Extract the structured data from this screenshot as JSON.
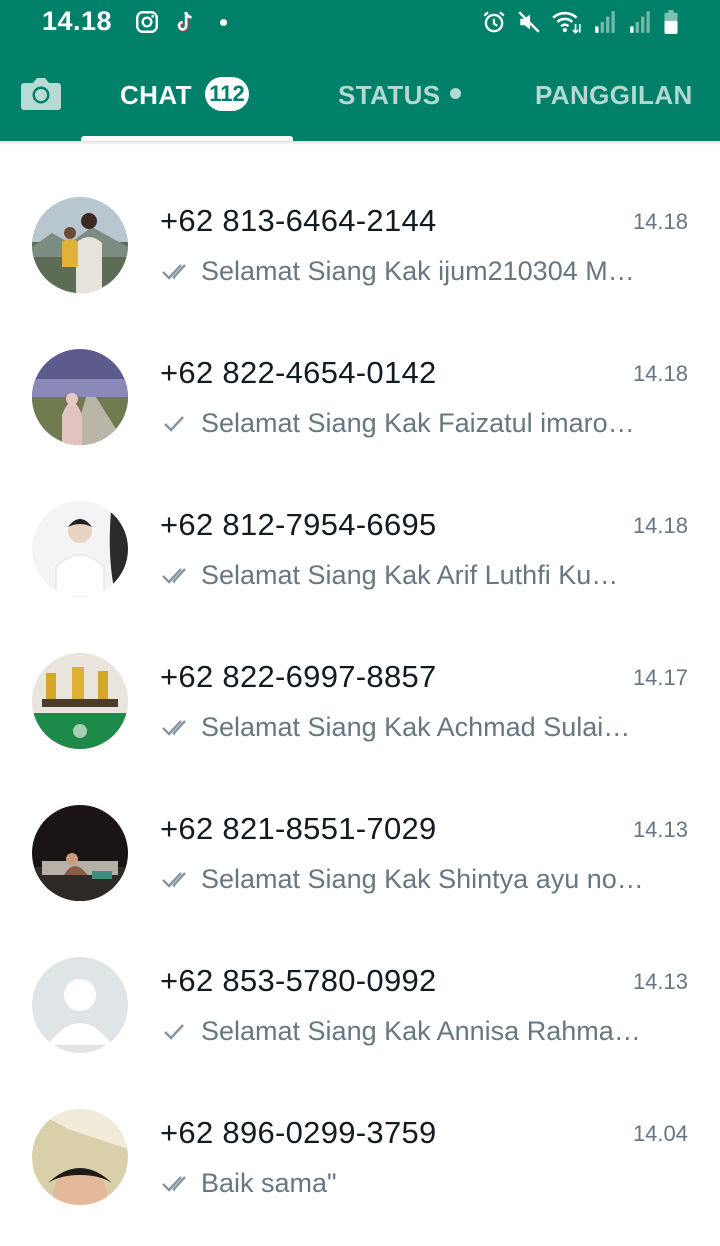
{
  "status_bar": {
    "time": "14.18",
    "left_icons": [
      "instagram-icon",
      "tiktok-icon",
      "notification-dot"
    ],
    "right_icons": [
      "alarm-icon",
      "mute-icon",
      "wifi-icon",
      "signal-icon",
      "signal-icon",
      "battery-icon"
    ]
  },
  "tabs": {
    "camera_icon": "camera-icon",
    "chat": "CHAT",
    "chat_badge": "112",
    "status": "STATUS",
    "calls": "PANGGILAN"
  },
  "colors": {
    "header": "#008069",
    "tick_gray": "#8696a0",
    "text_gray": "#667781"
  },
  "chats": [
    {
      "name": "+62 813-6464-2144",
      "time": "14.18",
      "preview": "Selamat Siang Kak ijum210304 M…",
      "ticks": "double"
    },
    {
      "name": "+62 822-4654-0142",
      "time": "14.18",
      "preview": "Selamat Siang Kak Faizatul imaro…",
      "ticks": "single"
    },
    {
      "name": "+62 812-7954-6695",
      "time": "14.18",
      "preview": "Selamat Siang Kak Arif Luthfi Ku…",
      "ticks": "double"
    },
    {
      "name": "+62 822-6997-8857",
      "time": "14.17",
      "preview": "Selamat Siang Kak Achmad Sulai…",
      "ticks": "double"
    },
    {
      "name": "+62 821-8551-7029",
      "time": "14.13",
      "preview": "Selamat Siang Kak Shintya ayu no…",
      "ticks": "double"
    },
    {
      "name": "+62 853-5780-0992",
      "time": "14.13",
      "preview": "Selamat Siang Kak Annisa Rahma…",
      "ticks": "single"
    },
    {
      "name": "+62 896-0299-3759",
      "time": "14.04",
      "preview": "Baik sama\"",
      "ticks": "double"
    }
  ]
}
